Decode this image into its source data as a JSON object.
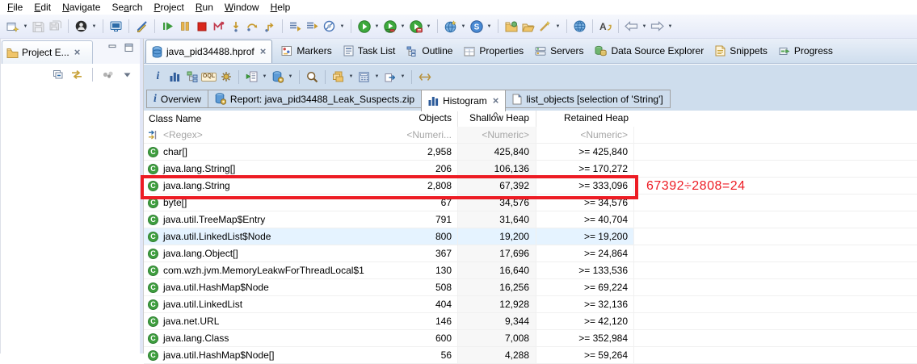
{
  "colors": {
    "highlight_box": "#ed1c24",
    "selected_row_bg": "#e5f3ff",
    "sorted_col_bg": "#f7f7f7",
    "mat_toolbar_bg": "#cedded"
  },
  "menu_bar": {
    "items": [
      {
        "pre": "",
        "key": "F",
        "rest": "ile"
      },
      {
        "pre": "",
        "key": "E",
        "rest": "dit"
      },
      {
        "pre": "",
        "key": "N",
        "rest": "avigate"
      },
      {
        "pre": "Se",
        "key": "a",
        "rest": "rch"
      },
      {
        "pre": "",
        "key": "P",
        "rest": "roject"
      },
      {
        "pre": "",
        "key": "R",
        "rest": "un"
      },
      {
        "pre": "",
        "key": "W",
        "rest": "indow"
      },
      {
        "pre": "",
        "key": "H",
        "rest": "elp"
      }
    ]
  },
  "main_toolbar": {
    "items": [
      {
        "icon": "new-wizard",
        "dropdown": true
      },
      {
        "icon": "save",
        "disabled": true
      },
      {
        "icon": "save-all",
        "disabled": true
      },
      {
        "sep": true
      },
      {
        "icon": "user-account",
        "dropdown": true
      },
      {
        "sep": true
      },
      {
        "icon": "open-console"
      },
      {
        "sep": true
      },
      {
        "icon": "mark-occurrences"
      },
      {
        "sep": true
      },
      {
        "icon": "resume"
      },
      {
        "icon": "pause"
      },
      {
        "icon": "terminate"
      },
      {
        "icon": "disconnect"
      },
      {
        "icon": "step-into"
      },
      {
        "icon": "step-over"
      },
      {
        "icon": "step-return"
      },
      {
        "sep": true
      },
      {
        "icon": "show-execution"
      },
      {
        "icon": "show-execution-alt"
      },
      {
        "icon": "skip-breakpoints",
        "dropdown": true
      },
      {
        "sep": true
      },
      {
        "icon": "run",
        "dropdown": true
      },
      {
        "icon": "coverage",
        "dropdown": true
      },
      {
        "icon": "profile",
        "dropdown": true
      },
      {
        "sep": true
      },
      {
        "icon": "new-browser",
        "dropdown": true
      },
      {
        "icon": "spring-boot",
        "dropdown": true
      },
      {
        "sep": true
      },
      {
        "icon": "import-folder"
      },
      {
        "icon": "open-folder"
      },
      {
        "icon": "search-wand",
        "dropdown": true
      },
      {
        "sep": true
      },
      {
        "icon": "web-globe"
      },
      {
        "sep": true
      },
      {
        "icon": "last-edit-location"
      },
      {
        "sep": true
      },
      {
        "icon": "back",
        "dropdown": true
      },
      {
        "icon": "forward",
        "dropdown": true
      }
    ]
  },
  "left_panel": {
    "tab_label": "Project E...",
    "window_buttons": [
      "minimize",
      "maximize"
    ],
    "toolbar_icons": [
      "collapse-all",
      "link-with-editor",
      "sep",
      "view-menu",
      "chevron-down"
    ]
  },
  "editor_tabs": {
    "active": {
      "icon": "heap-dump",
      "label": "java_pid34488.hprof",
      "closable": true
    },
    "views": [
      {
        "icon": "markers",
        "label": "Markers"
      },
      {
        "icon": "task-list",
        "label": "Task List"
      },
      {
        "icon": "outline",
        "label": "Outline"
      },
      {
        "icon": "properties",
        "label": "Properties"
      },
      {
        "icon": "servers",
        "label": "Servers"
      },
      {
        "icon": "data-source-explorer",
        "label": "Data Source Explorer"
      },
      {
        "icon": "snippets",
        "label": "Snippets"
      },
      {
        "icon": "progress",
        "label": "Progress"
      }
    ]
  },
  "mat_toolbar": {
    "items": [
      {
        "icon": "info"
      },
      {
        "icon": "histogram"
      },
      {
        "icon": "dominator-tree"
      },
      {
        "icon": "oql"
      },
      {
        "icon": "settings-gear"
      },
      {
        "sep": true
      },
      {
        "icon": "run-inspection",
        "dropdown": true
      },
      {
        "icon": "heap-dump-actions",
        "dropdown": true
      },
      {
        "sep": true
      },
      {
        "icon": "search"
      },
      {
        "sep": true
      },
      {
        "icon": "group-by",
        "dropdown": true
      },
      {
        "icon": "calculate-retained",
        "dropdown": true
      },
      {
        "icon": "export",
        "dropdown": true
      },
      {
        "sep": true
      },
      {
        "icon": "compare"
      }
    ]
  },
  "result_tabs": [
    {
      "icon": "info",
      "label": "Overview",
      "active": false
    },
    {
      "icon": "report",
      "label": "Report: java_pid34488_Leak_Suspects.zip",
      "active": false
    },
    {
      "icon": "histogram",
      "label": "Histogram",
      "active": true,
      "closable": true
    },
    {
      "icon": "page",
      "label": "list_objects [selection of 'String']",
      "active": false
    }
  ],
  "table": {
    "columns": [
      "Class Name",
      "Objects",
      "Shallow Heap",
      "Retained Heap"
    ],
    "sort_column": "Shallow Heap",
    "filter_row": [
      "<Regex>",
      "<Numeri...",
      "<Numeric>",
      "<Numeric>"
    ],
    "rows": [
      {
        "class_name": "char[]",
        "objects": "2,958",
        "shallow_heap": "425,840",
        "retained_heap": ">= 425,840"
      },
      {
        "class_name": "java.lang.String[]",
        "objects": "206",
        "shallow_heap": "106,136",
        "retained_heap": ">= 170,272"
      },
      {
        "class_name": "java.lang.String",
        "objects": "2,808",
        "shallow_heap": "67,392",
        "retained_heap": ">= 333,096",
        "highlighted": true
      },
      {
        "class_name": "byte[]",
        "objects": "67",
        "shallow_heap": "34,576",
        "retained_heap": ">= 34,576"
      },
      {
        "class_name": "java.util.TreeMap$Entry",
        "objects": "791",
        "shallow_heap": "31,640",
        "retained_heap": ">= 40,704"
      },
      {
        "class_name": "java.util.LinkedList$Node",
        "objects": "800",
        "shallow_heap": "19,200",
        "retained_heap": ">= 19,200",
        "selected": true
      },
      {
        "class_name": "java.lang.Object[]",
        "objects": "367",
        "shallow_heap": "17,696",
        "retained_heap": ">= 24,864"
      },
      {
        "class_name": "com.wzh.jvm.MemoryLeakwForThreadLocal$1",
        "objects": "130",
        "shallow_heap": "16,640",
        "retained_heap": ">= 133,536"
      },
      {
        "class_name": "java.util.HashMap$Node",
        "objects": "508",
        "shallow_heap": "16,256",
        "retained_heap": ">= 69,224"
      },
      {
        "class_name": "java.util.LinkedList",
        "objects": "404",
        "shallow_heap": "12,928",
        "retained_heap": ">= 32,136"
      },
      {
        "class_name": "java.net.URL",
        "objects": "146",
        "shallow_heap": "9,344",
        "retained_heap": ">= 42,120"
      },
      {
        "class_name": "java.lang.Class",
        "objects": "600",
        "shallow_heap": "7,008",
        "retained_heap": ">= 352,984"
      },
      {
        "class_name": "java.util.HashMap$Node[]",
        "objects": "56",
        "shallow_heap": "4,288",
        "retained_heap": ">= 59,264"
      }
    ]
  },
  "annotation": {
    "formula": "67392÷2808=24",
    "color": "#ed1c24"
  }
}
